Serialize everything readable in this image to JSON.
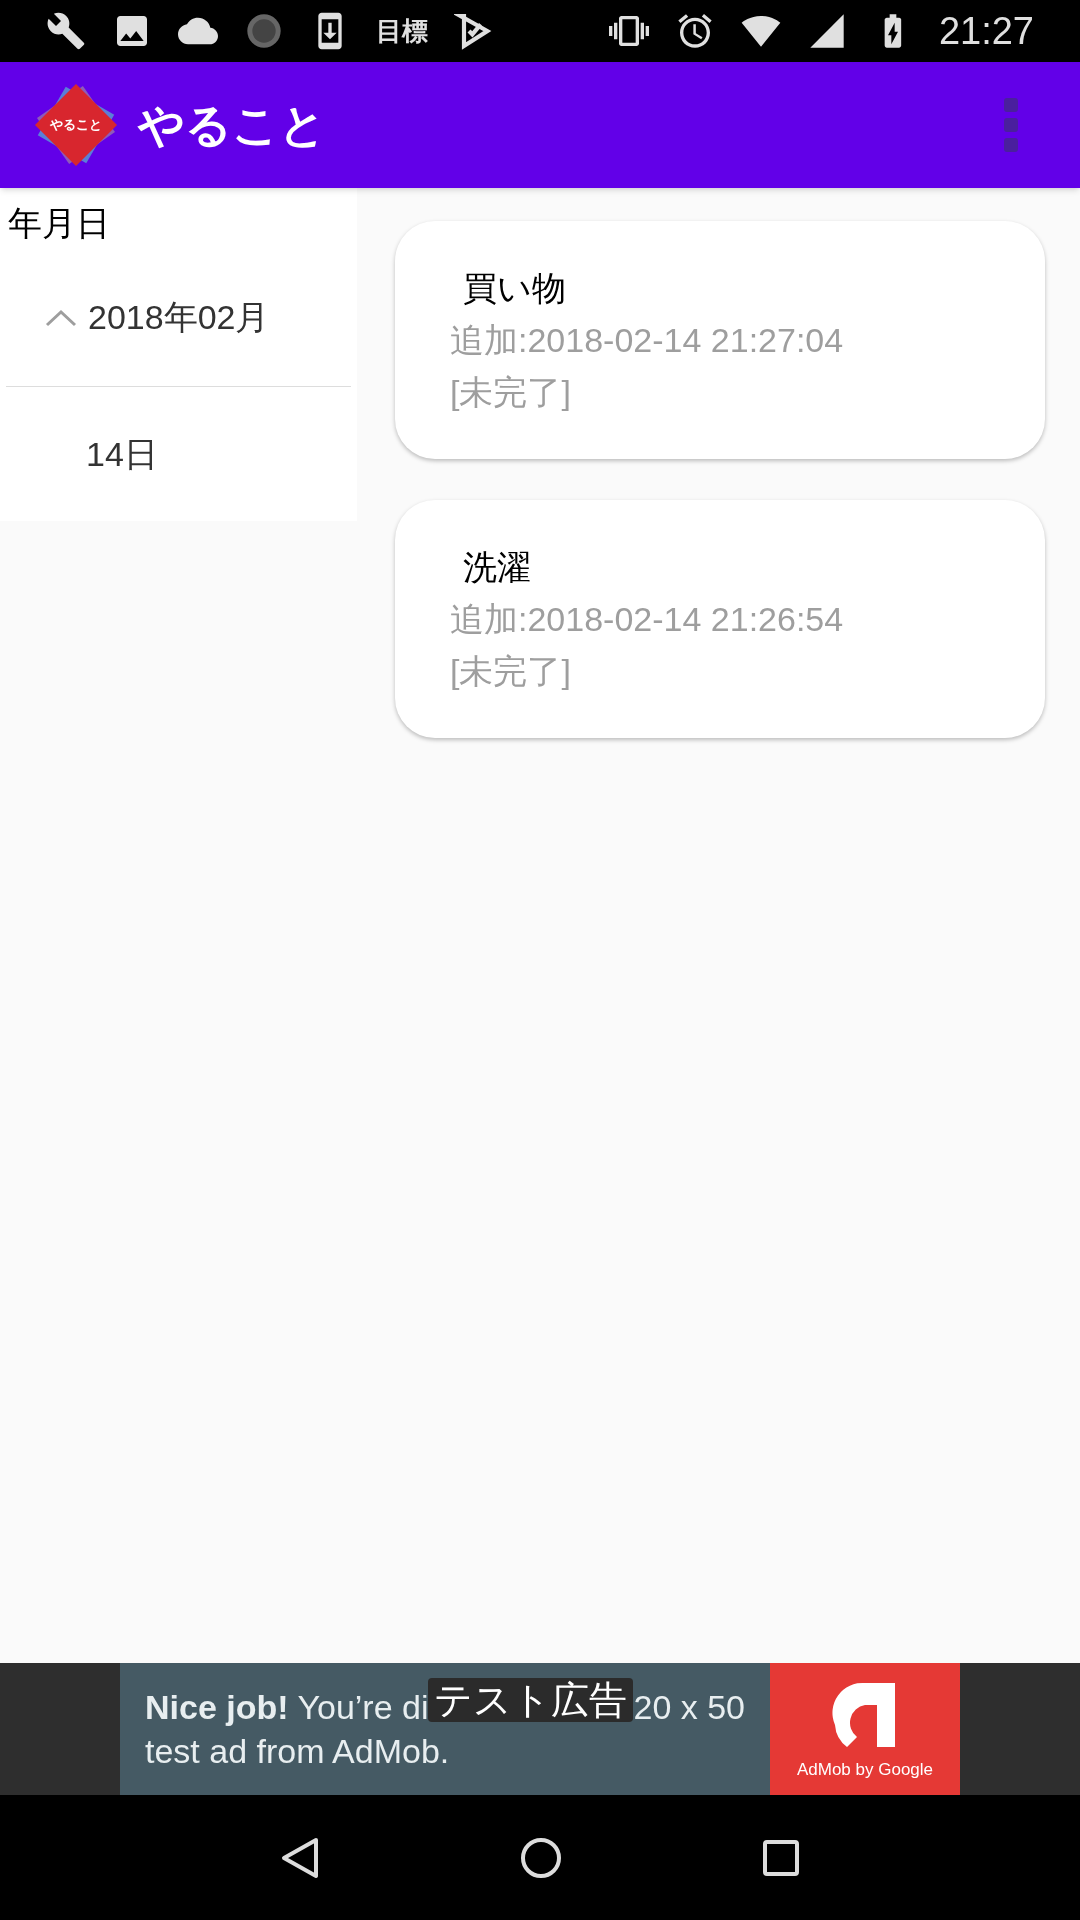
{
  "status_bar": {
    "notification_text": "目標",
    "time": "21:27"
  },
  "app_bar": {
    "logo_text": "やること",
    "title": "やること"
  },
  "sidebar": {
    "heading": "年月日",
    "groups": [
      {
        "label": "2018年02月",
        "expanded": true,
        "children": [
          {
            "label": "14日"
          }
        ]
      }
    ]
  },
  "tasks": [
    {
      "title": "買い物",
      "added": "追加:2018-02-14 21:27:04",
      "status": "[未完了]"
    },
    {
      "title": "洗濯",
      "added": "追加:2018-02-14 21:26:54",
      "status": "[未完了]"
    }
  ],
  "ad": {
    "line_1_start": "**Nice job!** You’re di",
    "overlay_badge": "テスト広告",
    "line_1_end": "20 x 50",
    "line_2": "test ad from AdMob.",
    "brand": "AdMob by Google"
  }
}
